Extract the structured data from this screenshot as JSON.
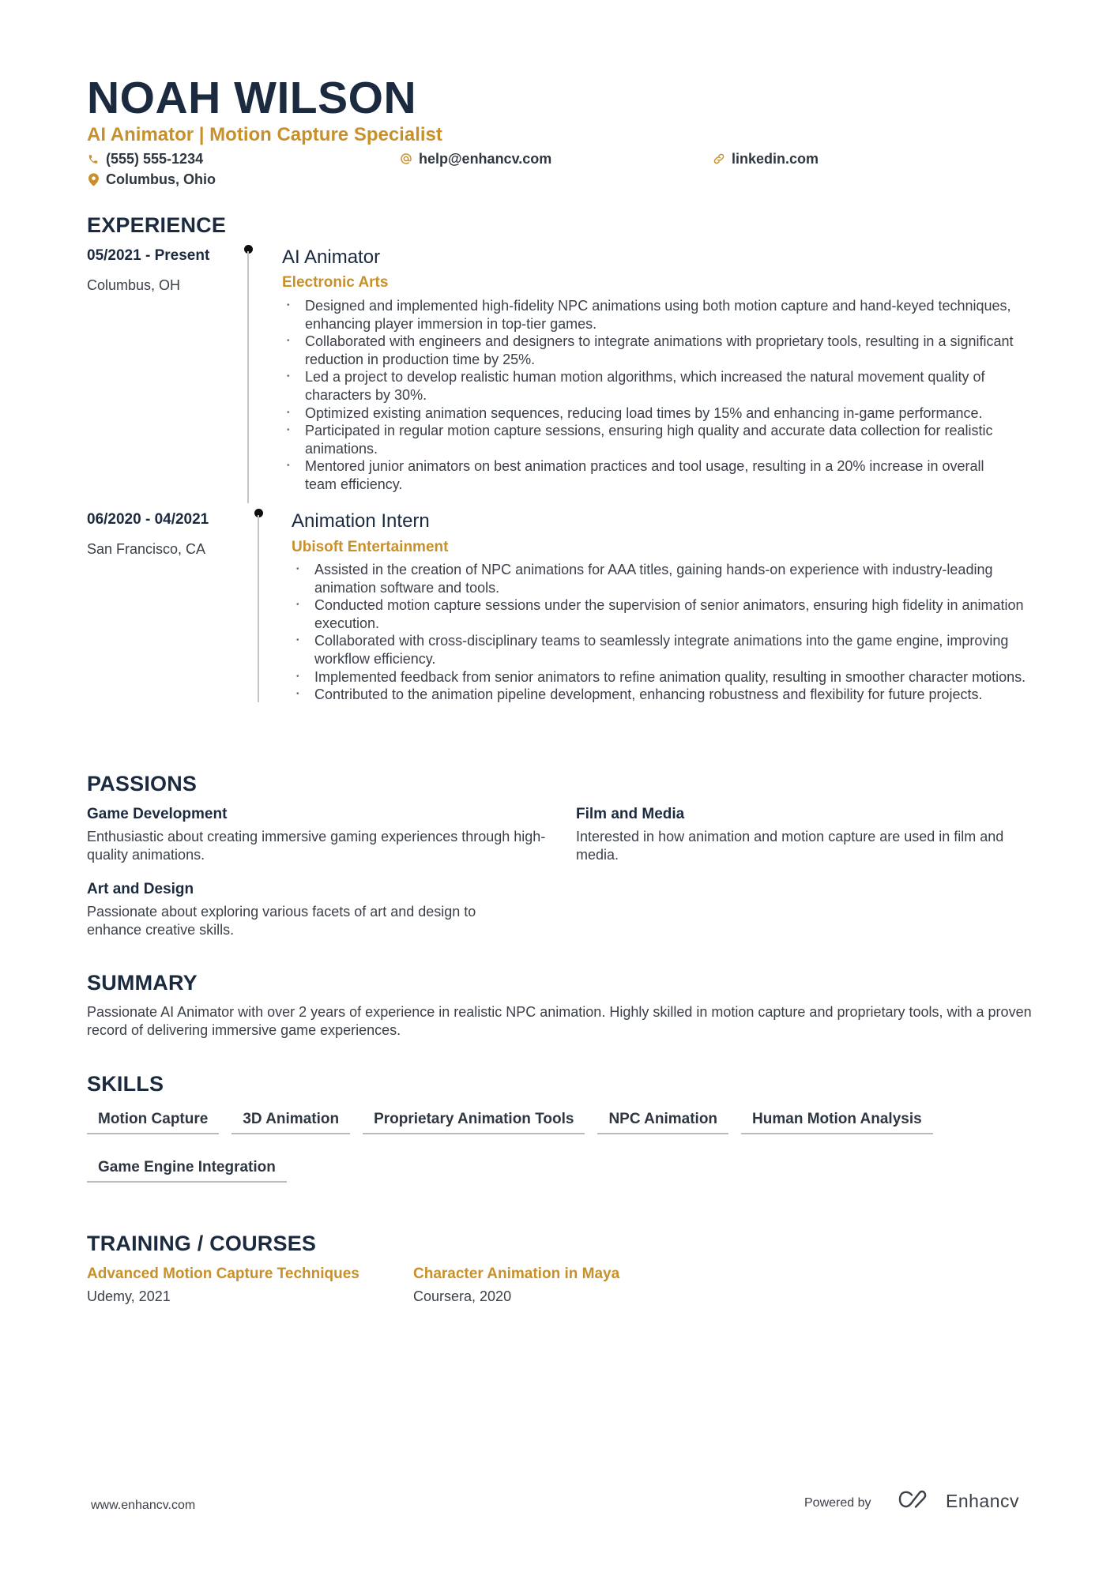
{
  "header": {
    "name": "NOAH WILSON",
    "headline": "AI Animator | Motion Capture Specialist",
    "contacts": {
      "phone": {
        "icon": "phone-icon",
        "text": "(555) 555-1234"
      },
      "email": {
        "icon": "at-icon",
        "text": "help@enhancv.com"
      },
      "link": {
        "icon": "link-icon",
        "text": "linkedin.com"
      },
      "location": {
        "icon": "map-pin-icon",
        "text": "Columbus, Ohio"
      }
    }
  },
  "colors": {
    "accent": "#c8902a",
    "heading": "#1b2a3f",
    "body": "#3b4048"
  },
  "experience": {
    "title": "EXPERIENCE",
    "items": [
      {
        "dates": "05/2021 - Present",
        "location": "Columbus, OH",
        "role": "AI Animator",
        "company": "Electronic Arts",
        "bullets": [
          "Designed and implemented high-fidelity NPC animations using both motion capture and hand-keyed techniques, enhancing player immersion in top-tier games.",
          "Collaborated with engineers and designers to integrate animations with proprietary tools, resulting in a significant reduction in production time by 25%.",
          "Led a project to develop realistic human motion algorithms, which increased the natural movement quality of characters by 30%.",
          "Optimized existing animation sequences, reducing load times by 15% and enhancing in-game performance.",
          "Participated in regular motion capture sessions, ensuring high quality and accurate data collection for realistic animations.",
          "Mentored junior animators on best animation practices and tool usage, resulting in a 20% increase in overall team efficiency."
        ]
      },
      {
        "dates": "06/2020 - 04/2021",
        "location": "San Francisco, CA",
        "role": "Animation Intern",
        "company": "Ubisoft Entertainment",
        "bullets": [
          "Assisted in the creation of NPC animations for AAA titles, gaining hands-on experience with industry-leading animation software and tools.",
          "Conducted motion capture sessions under the supervision of senior animators, ensuring high fidelity in animation execution.",
          "Collaborated with cross-disciplinary teams to seamlessly integrate animations into the game engine, improving workflow efficiency.",
          "Implemented feedback from senior animators to refine animation quality, resulting in smoother character motions.",
          "Contributed to the animation pipeline development, enhancing robustness and flexibility for future projects."
        ]
      }
    ]
  },
  "passions": {
    "title": "PASSIONS",
    "items": [
      {
        "title": "Game Development",
        "description": "Enthusiastic about creating immersive gaming experiences through high-quality animations."
      },
      {
        "title": "Film and Media",
        "description": "Interested in how animation and motion capture are used in film and media."
      },
      {
        "title": "Art and Design",
        "description": "Passionate about exploring various facets of art and design to enhance creative skills."
      }
    ]
  },
  "summary": {
    "title": "SUMMARY",
    "text": "Passionate AI Animator with over 2 years of experience in realistic NPC animation. Highly skilled in motion capture and proprietary tools, with a proven record of delivering immersive game experiences."
  },
  "skills": {
    "title": "SKILLS",
    "items": [
      "Motion Capture",
      "3D Animation",
      "Proprietary Animation Tools",
      "NPC Animation",
      "Human Motion Analysis",
      "Game Engine Integration"
    ]
  },
  "training": {
    "title": "TRAINING / COURSES",
    "items": [
      {
        "title": "Advanced Motion Capture Techniques",
        "meta": "Udemy, 2021"
      },
      {
        "title": "Character Animation in Maya",
        "meta": "Coursera, 2020"
      }
    ]
  },
  "footer": {
    "url": "www.enhancv.com",
    "powered_by": "Powered by",
    "brand": "Enhancv",
    "brand_icon": "enhancv-logo-icon"
  }
}
